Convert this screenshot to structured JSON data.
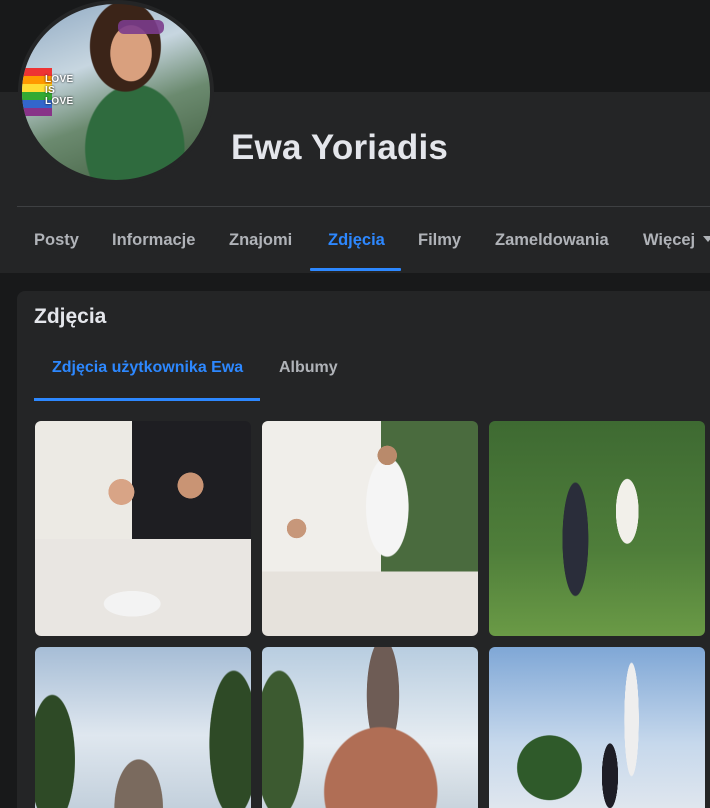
{
  "profile": {
    "name": "Ewa Yoriadis",
    "avatar_overlay_text": [
      "LOVE",
      "IS",
      "LOVE"
    ],
    "flag_colors": [
      "#e33",
      "#f90",
      "#fd3",
      "#3a3",
      "#36c",
      "#838"
    ]
  },
  "nav": {
    "tabs": [
      {
        "label": "Posty"
      },
      {
        "label": "Informacje"
      },
      {
        "label": "Znajomi"
      },
      {
        "label": "Zdjęcia",
        "active": true
      },
      {
        "label": "Filmy"
      },
      {
        "label": "Zameldowania"
      },
      {
        "label": "Więcej",
        "has_dropdown": true
      }
    ]
  },
  "photos": {
    "title": "Zdjęcia",
    "subtabs": [
      {
        "label": "Zdjęcia użytkownika Ewa",
        "active": true
      },
      {
        "label": "Albumy"
      }
    ],
    "items": [
      "wedding-photo-1",
      "wedding-photo-2",
      "wedding-photo-3",
      "castle-photo-1",
      "castle-photo-2",
      "terrace-photo"
    ]
  },
  "colors": {
    "accent": "#2d88ff",
    "background": "#18191a",
    "card": "#242526",
    "text_primary": "#e4e6eb",
    "text_secondary": "#b0b3b8"
  }
}
